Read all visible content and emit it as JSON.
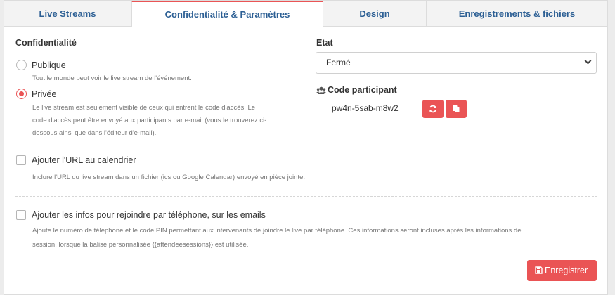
{
  "tabs": [
    {
      "label": "Live Streams",
      "active": false
    },
    {
      "label": "Confidentialité & Paramètres",
      "active": true
    },
    {
      "label": "Design",
      "active": false
    },
    {
      "label": "Enregistrements & fichiers",
      "active": false
    }
  ],
  "privacy": {
    "heading": "Confidentialité",
    "public_label": "Publique",
    "public_help": "Tout le monde peut voir le live stream de l'événement.",
    "private_label": "Privée",
    "private_help_line1": "Le live stream est seulement visible de ceux qui entrent le code d'accès. Le",
    "private_help_line2": "code d'accès peut être envoyé aux participants par e-mail (vous le trouverez ci-",
    "private_help_line3": "dessous ainsi que dans l'éditeur d'e-mail).",
    "selected": "private"
  },
  "calendar": {
    "label": "Ajouter l'URL au calendrier",
    "help": "Inclure l'URL du live stream dans un fichier (ics ou Google Calendar) envoyé en pièce jointe.",
    "checked": false
  },
  "phone": {
    "label": "Ajouter les infos pour rejoindre par téléphone, sur les emails",
    "help_line1": "Ajoute le numéro de téléphone et le code PIN permettant aux intervenants de joindre le live par téléphone. Ces informations seront incluses après les informations de",
    "help_line2": "session, lorsque la balise personnalisée {{attendeesessions}} est utilisée.",
    "checked": false
  },
  "state": {
    "heading": "Etat",
    "value": "Fermé"
  },
  "participant_code": {
    "heading": "Code participant",
    "icon": "users-icon",
    "value": "pw4n-5sab-m8w2"
  },
  "save_button": {
    "label": "Enregistrer",
    "icon": "floppy-disk-icon"
  },
  "colors": {
    "accent": "#ea5455",
    "tab_text": "#2c5f94"
  }
}
